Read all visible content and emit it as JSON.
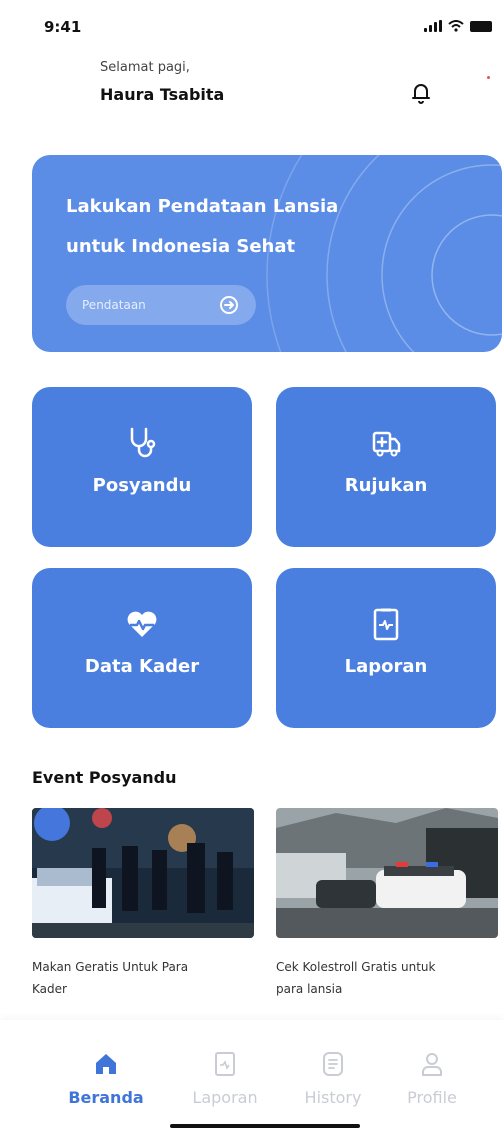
{
  "status_bar": {
    "time": "9:41"
  },
  "header": {
    "greeting": "Selamat pagi,",
    "user_name": "Haura Tsabita"
  },
  "banner": {
    "title_line1": "Lakukan Pendataan Lansia",
    "title_line2": "untuk Indonesia Sehat",
    "button_label": "Pendataan"
  },
  "menu": [
    {
      "label": "Posyandu",
      "icon": "stethoscope-icon"
    },
    {
      "label": "Rujukan",
      "icon": "ambulance-icon"
    },
    {
      "label": "Data Kader",
      "icon": "heart-pulse-icon"
    },
    {
      "label": "Laporan",
      "icon": "report-icon"
    }
  ],
  "events": {
    "section_title": "Event Posyandu",
    "items": [
      {
        "title_line1": "Makan Geratis Untuk Para",
        "title_line2": "Kader"
      },
      {
        "title_line1": "Cek Kolestroll Gratis untuk",
        "title_line2": "para lansia"
      }
    ]
  },
  "nav": [
    {
      "label": "Beranda",
      "icon": "home-icon",
      "active": true
    },
    {
      "label": "Laporan",
      "icon": "report-icon",
      "active": false
    },
    {
      "label": "History",
      "icon": "history-icon",
      "active": false
    },
    {
      "label": "Profile",
      "icon": "user-icon",
      "active": false
    }
  ],
  "colors": {
    "primary": "#4a7fe0",
    "banner": "#5b8de6",
    "nav_active": "#3f74d8",
    "nav_inactive": "#c9ccd4"
  }
}
